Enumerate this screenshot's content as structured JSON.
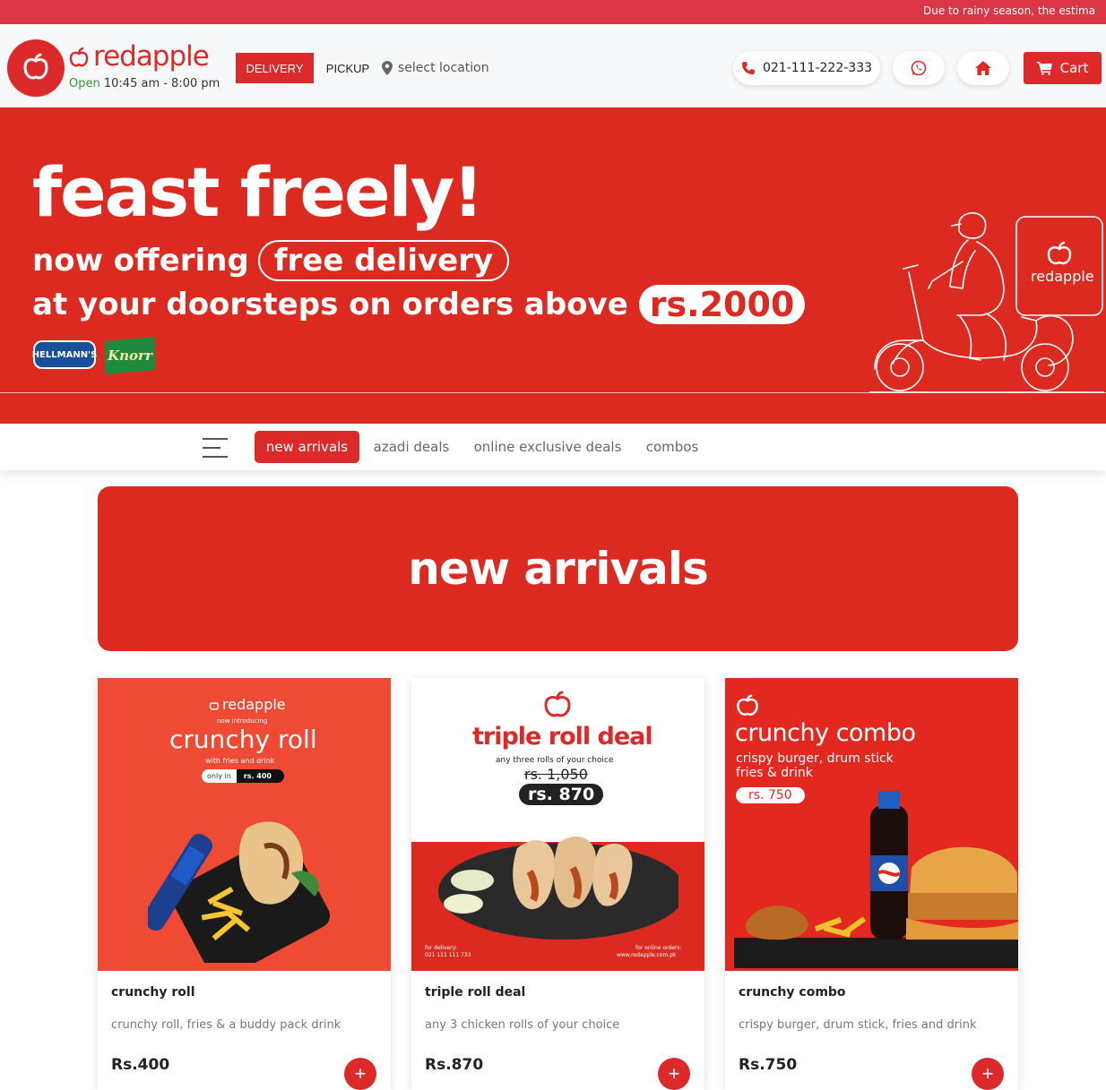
{
  "announcement": "Due to rainy season, the estima",
  "header": {
    "brand": "redapple",
    "open_label": "Open",
    "hours": "10:45 am - 8:00 pm",
    "delivery_label": "DELIVERY",
    "pickup_label": "PICKUP",
    "location_label": "select location",
    "phone": "021-111-222-333",
    "cart_label": "Cart"
  },
  "hero": {
    "headline": "feast freely!",
    "line2_prefix": "now offering",
    "line2_pill": "free delivery",
    "line3_prefix": "at your doorsteps on orders above",
    "line3_price": "rs.2000",
    "sponsor1": "HELLMANN'S",
    "sponsor2": "Knorr",
    "scooter_brand": "redapple"
  },
  "categories": [
    {
      "label": "new arrivals",
      "active": true
    },
    {
      "label": "azadi deals",
      "active": false
    },
    {
      "label": "online exclusive deals",
      "active": false
    },
    {
      "label": "combos",
      "active": false
    }
  ],
  "section_title": "new arrivals",
  "products": [
    {
      "name": "crunchy roll",
      "description": "crunchy roll, fries & a buddy pack drink",
      "price": "Rs.400",
      "add_label": "+",
      "img": {
        "brand": "redapple",
        "kicker": "now introducing",
        "title": "crunchy roll",
        "sub": "with fries and drink",
        "only_in": "only in",
        "price": "rs. 400"
      }
    },
    {
      "name": "triple roll deal",
      "description": "any 3 chicken rolls of your choice",
      "price": "Rs.870",
      "add_label": "+",
      "img": {
        "title": "triple roll deal",
        "sub": "any three rolls of your choice",
        "old_price": "rs. 1,050",
        "price": "rs. 870",
        "delivery_label": "for delivery:",
        "delivery_number": "021 111 111 733",
        "online_label": "for online orders:",
        "online_url": "www.redapple.com.pk"
      }
    },
    {
      "name": "crunchy combo",
      "description": "crispy burger, drum stick, fries and drink",
      "price": "Rs.750",
      "add_label": "+",
      "img": {
        "title": "crunchy combo",
        "sub1": "crispy burger, drum stick",
        "sub2": "fries & drink",
        "price": "rs. 750"
      }
    }
  ],
  "colors": {
    "brand_red": "#dc2a2a",
    "ticker_red": "#dc3545",
    "open_green": "#2e9a3a"
  }
}
